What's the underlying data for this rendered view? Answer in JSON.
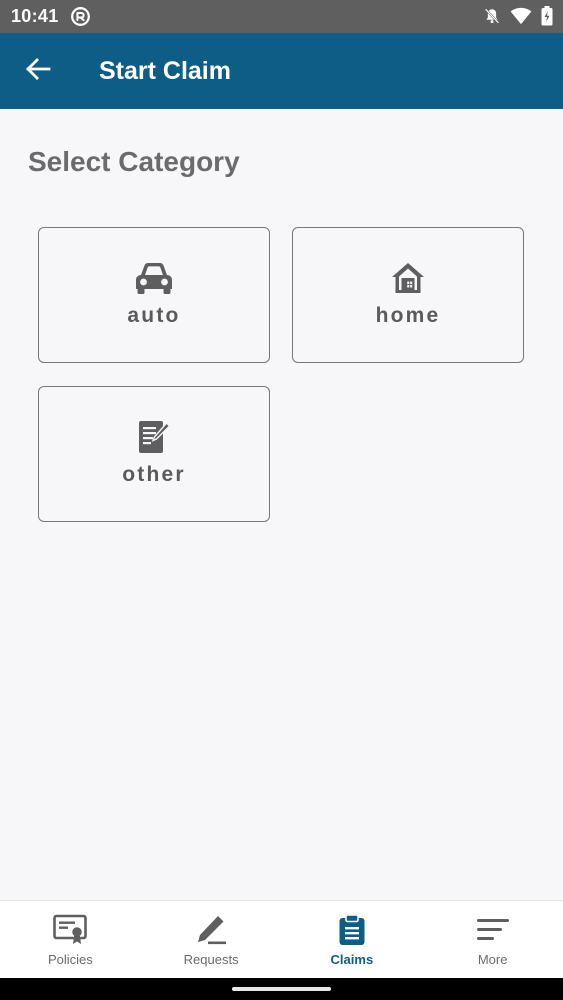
{
  "status_bar": {
    "time": "10:41"
  },
  "app_bar": {
    "title": "Start Claim"
  },
  "content": {
    "section_title": "Select Category",
    "categories": [
      {
        "label": "auto",
        "icon": "car-icon"
      },
      {
        "label": "home",
        "icon": "house-icon"
      },
      {
        "label": "other",
        "icon": "document-edit-icon"
      }
    ]
  },
  "bottom_nav": {
    "items": [
      {
        "label": "Policies",
        "icon": "certificate-icon",
        "active": false
      },
      {
        "label": "Requests",
        "icon": "pencil-icon",
        "active": false
      },
      {
        "label": "Claims",
        "icon": "clipboard-icon",
        "active": true
      },
      {
        "label": "More",
        "icon": "menu-lines-icon",
        "active": false
      }
    ]
  },
  "colors": {
    "primary": "#0e5d86",
    "status_bar": "#5f5f5f",
    "background": "#f7f6f9",
    "text_gray": "#6b6b6b"
  }
}
